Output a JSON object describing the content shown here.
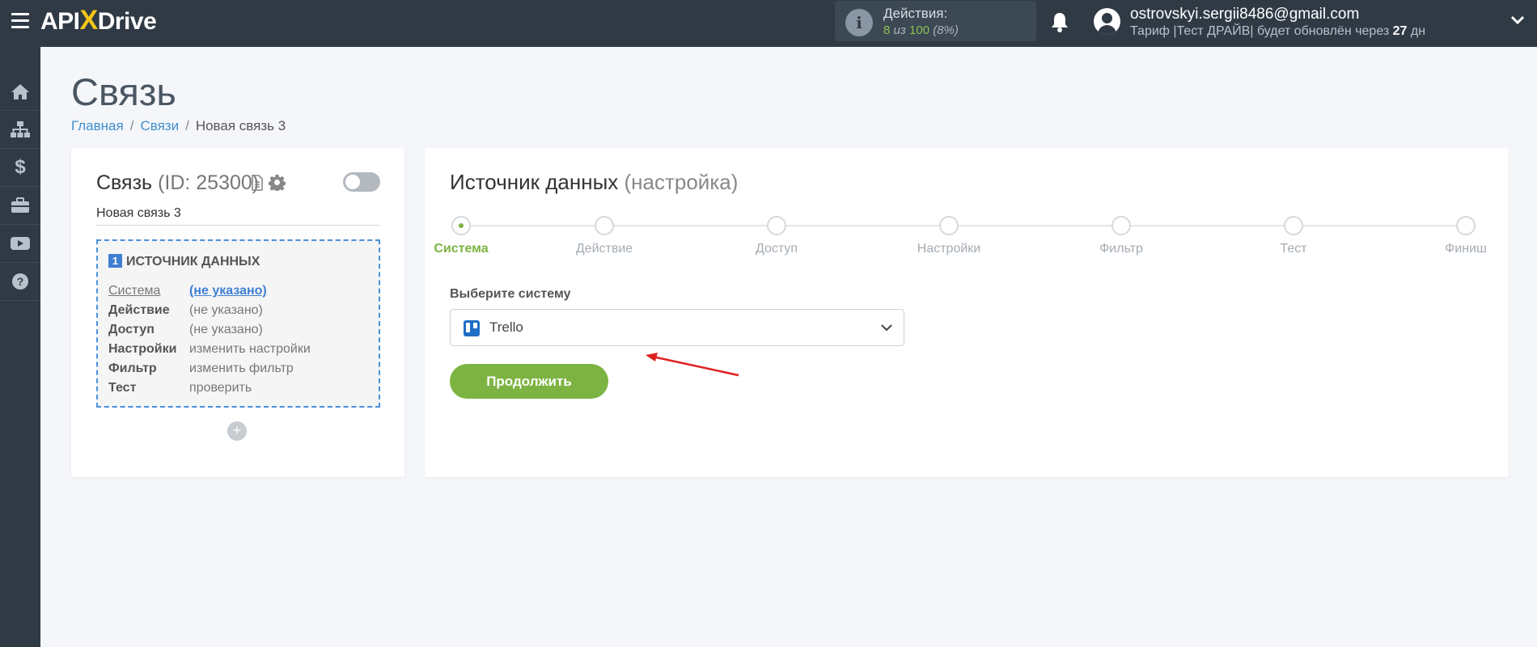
{
  "topbar": {
    "logo": {
      "left": "API",
      "x": "X",
      "right": "Drive"
    },
    "actions": {
      "title": "Действия:",
      "used": "8",
      "of_word": "из",
      "total": "100",
      "percent": "(8%)"
    },
    "user": {
      "email": "ostrovskyi.sergii8486@gmail.com",
      "tariff_prefix": "Тариф |Тест ДРАЙВ| будет обновлён через",
      "days": "27",
      "days_suffix": "дн"
    }
  },
  "sidebar": {
    "icons": [
      "home-icon",
      "sitemap-icon",
      "dollar-icon",
      "briefcase-icon",
      "youtube-icon",
      "help-icon"
    ]
  },
  "header": {
    "title": "Связь",
    "breadcrumb": {
      "home": "Главная",
      "links": "Связи",
      "current": "Новая связь 3"
    }
  },
  "left_card": {
    "title": "Связь",
    "id_text": "(ID: 25300)",
    "name": "Новая связь 3",
    "source": {
      "num": "1",
      "heading": "ИСТОЧНИК ДАННЫХ",
      "rows": [
        {
          "k": "Система",
          "v": "(не указано)"
        },
        {
          "k": "Действие",
          "v": "(не указано)"
        },
        {
          "k": "Доступ",
          "v": "(не указано)"
        },
        {
          "k": "Настройки",
          "v": "изменить настройки"
        },
        {
          "k": "Фильтр",
          "v": "изменить фильтр"
        },
        {
          "k": "Тест",
          "v": "проверить"
        }
      ]
    },
    "add": "+"
  },
  "right_card": {
    "title": "Источник данных",
    "subtitle": "(настройка)",
    "steps": [
      "Система",
      "Действие",
      "Доступ",
      "Настройки",
      "Фильтр",
      "Тест",
      "Финиш"
    ],
    "active_step": 0,
    "select_label": "Выберите систему",
    "select_value": "Trello",
    "continue": "Продолжить"
  },
  "colors": {
    "accent_green": "#7cb342",
    "topbar": "#2f3a45",
    "link_blue": "#3f8fcf",
    "arrow_red": "#e02020"
  }
}
